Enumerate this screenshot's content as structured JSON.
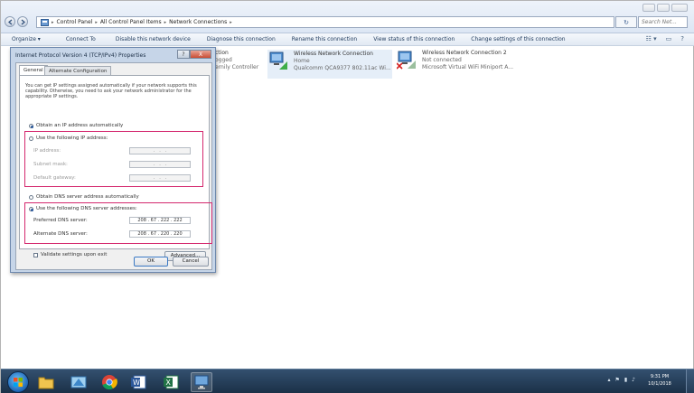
{
  "explorer": {
    "breadcrumbs": [
      "Control Panel",
      "All Control Panel Items",
      "Network Connections"
    ],
    "search_placeholder": "Search Net...",
    "toolbar": [
      "Organize ▾",
      "Connect To",
      "Disable this network device",
      "Diagnose this connection",
      "Rename this connection",
      "View status of this connection",
      "Change settings of this connection"
    ],
    "connections": [
      {
        "title": "",
        "line1": "ction",
        "line2": "ogged",
        "line3": "ernily Controller"
      },
      {
        "title": "Wireless Network Connection",
        "line1": "Home",
        "line2": "Qualcomm QCA9377 802.11ac Wi..."
      },
      {
        "title": "Wireless Network Connection 2",
        "line1": "Not connected",
        "line2": "Microsoft Virtual WiFi Miniport A..."
      }
    ]
  },
  "dialog": {
    "title": "Internet Protocol Version 4 (TCP/IPv4) Properties",
    "help_label": "?",
    "close_label": "X",
    "tabs": [
      "General",
      "Alternate Configuration"
    ],
    "intro": "You can get IP settings assigned automatically if your network supports this capability. Otherwise, you need to ask your network administrator for the appropriate IP settings.",
    "ip_auto": "Obtain an IP address automatically",
    "ip_manual": "Use the following IP address:",
    "ip_address_label": "IP address:",
    "subnet_label": "Subnet mask:",
    "gateway_label": "Default gateway:",
    "empty_ip": ".   .   .",
    "dns_auto": "Obtain DNS server address automatically",
    "dns_manual": "Use the following DNS server addresses:",
    "preferred_label": "Preferred DNS server:",
    "preferred_value": "208 . 67 . 222 . 222",
    "alternate_label": "Alternate DNS server:",
    "alternate_value": "208 . 67 . 220 . 220",
    "validate_label": "Validate settings upon exit",
    "advanced_label": "Advanced...",
    "ok_label": "OK",
    "cancel_label": "Cancel"
  },
  "taskbar": {
    "time": "9:31 PM",
    "date": "10/1/2018"
  },
  "colors": {
    "highlight": "#d4286e",
    "accent": "#1f64b2"
  }
}
